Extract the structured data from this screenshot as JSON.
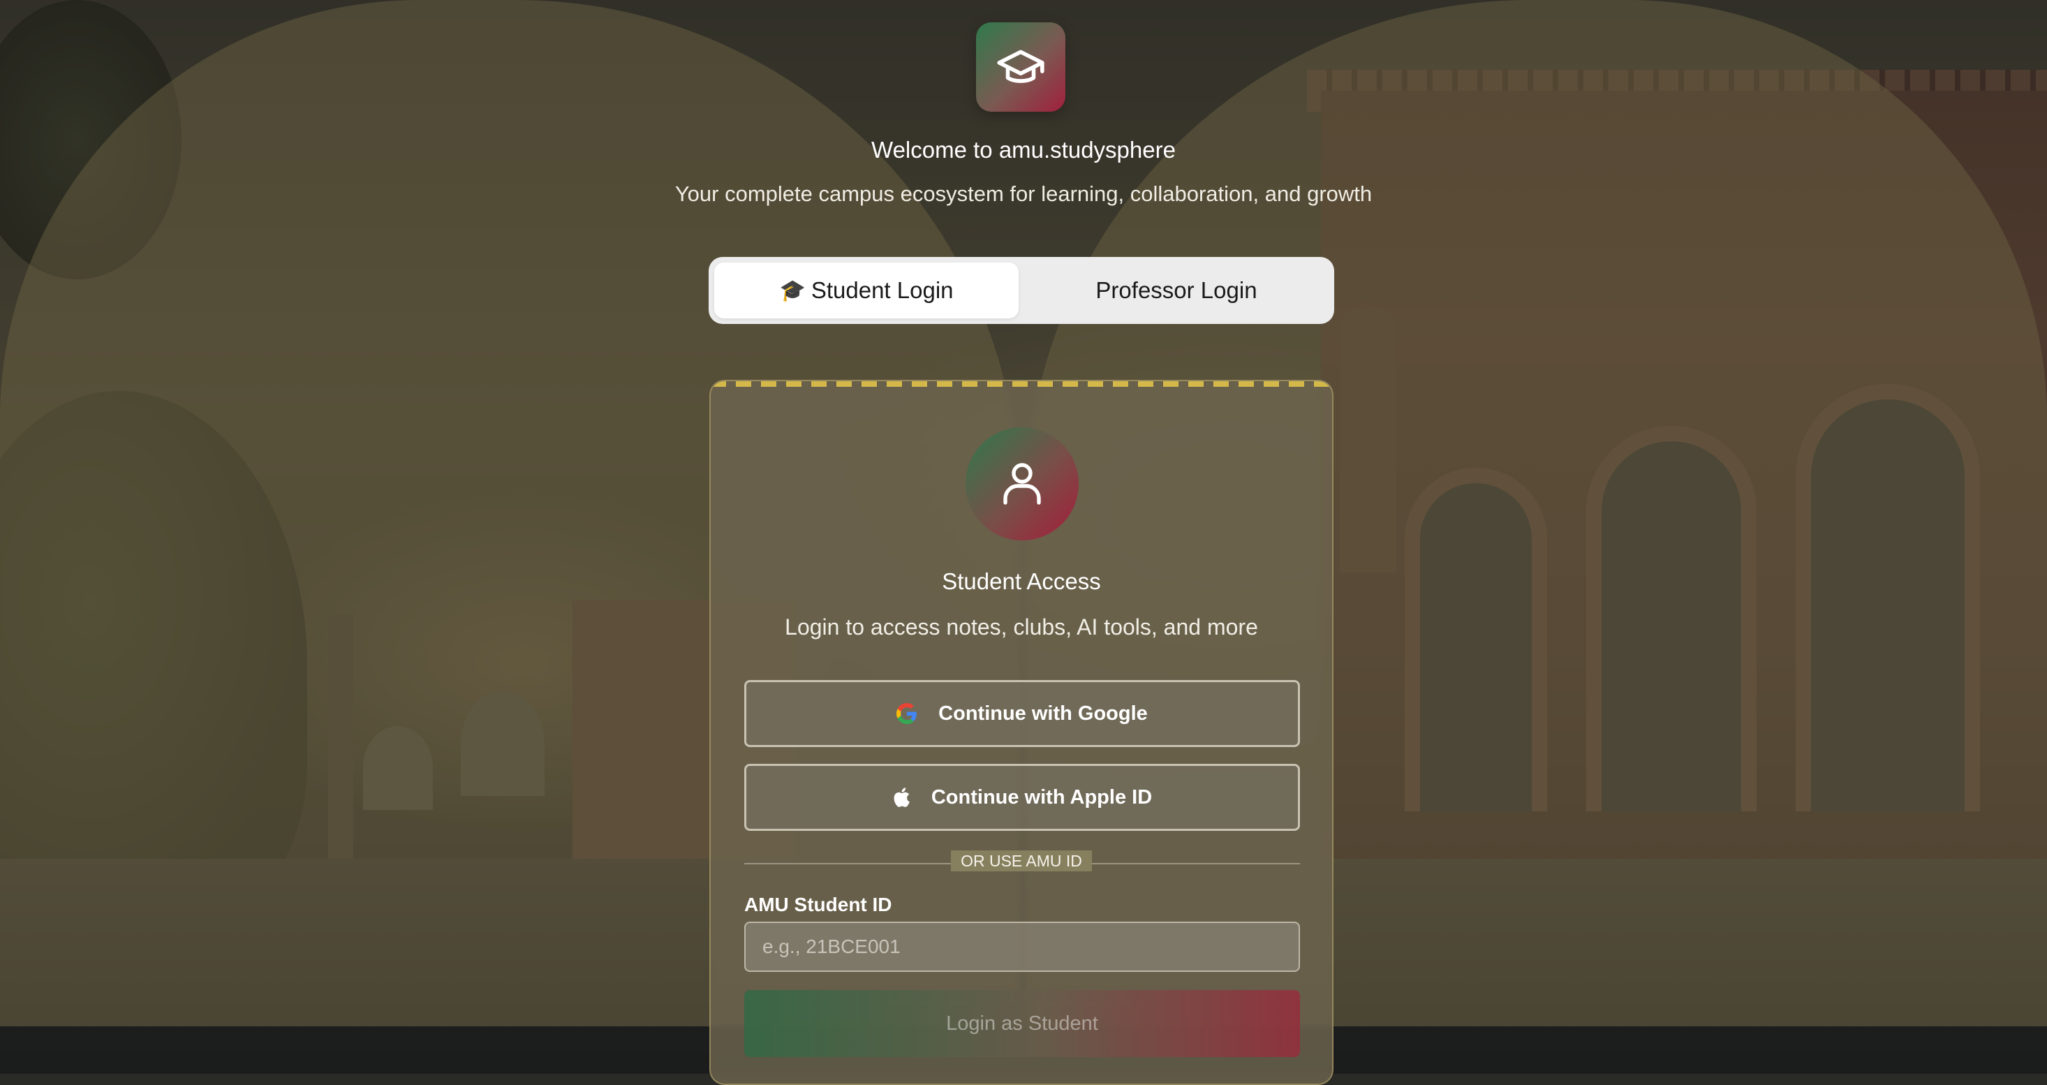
{
  "header": {
    "logo_icon": "graduation-cap-icon",
    "title": "Welcome to amu.studysphere",
    "subtitle": "Your complete campus ecosystem for learning, collaboration, and growth"
  },
  "tabs": [
    {
      "label": "Student Login",
      "icon": "🎓",
      "active": true
    },
    {
      "label": "Professor Login",
      "active": false
    }
  ],
  "card": {
    "avatar_icon": "user-icon",
    "title": "Student Access",
    "subtitle": "Login to access notes, clubs, AI tools, and more",
    "google_label": "Continue with Google",
    "apple_label": "Continue with Apple ID",
    "divider_label": "OR USE AMU ID",
    "field_label": "AMU Student ID",
    "field_placeholder": "e.g., 21BCE001",
    "field_value": "",
    "submit_label": "Login as Student"
  },
  "colors": {
    "brand_green": "#2f7a4d",
    "brand_red": "#a11f3c",
    "accent_gold": "#d4b94a"
  }
}
